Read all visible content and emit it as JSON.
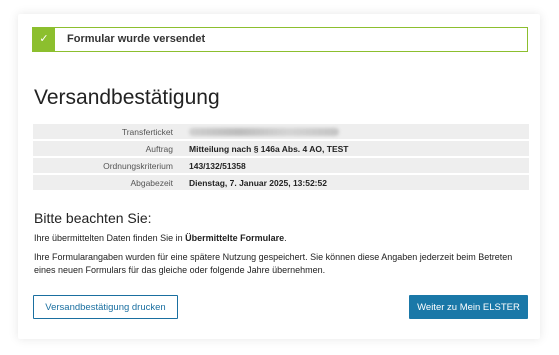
{
  "alert": {
    "icon": "check-icon",
    "text": "Formular wurde versendet",
    "color": "#8cbf2e"
  },
  "page": {
    "title": "Versandbestätigung"
  },
  "details": [
    {
      "label": "Transferticket",
      "value": ""
    },
    {
      "label": "Auftrag",
      "value": "Mitteilung nach § 146a Abs. 4 AO, TEST"
    },
    {
      "label": "Ordnungskriterium",
      "value": "143/132/51358"
    },
    {
      "label": "Abgabezeit",
      "value": "Dienstag, 7. Januar 2025, 13:52:52"
    }
  ],
  "notice": {
    "title": "Bitte beachten Sie:",
    "p1_prefix": "Ihre übermittelten Daten finden Sie in ",
    "p1_bold": "Übermittelte Formulare",
    "p1_suffix": ".",
    "p2": "Ihre Formularangaben wurden für eine spätere Nutzung gespeichert. Sie können diese Angaben jederzeit beim Betreten eines neuen Formulars für das gleiche oder folgende Jahre übernehmen."
  },
  "buttons": {
    "print": "Versandbestätigung drucken",
    "next": "Weiter zu Mein ELSTER"
  },
  "colors": {
    "accent_green": "#8cbf2e",
    "primary_blue": "#1a78a8"
  }
}
